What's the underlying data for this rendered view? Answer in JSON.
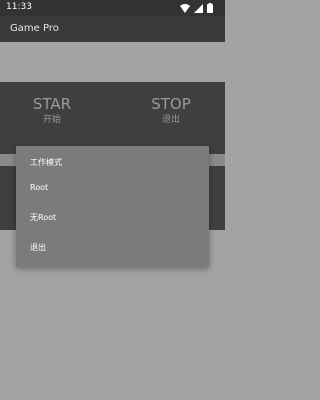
{
  "status_bar": {
    "time": "11:33",
    "icons": [
      "wifi-icon",
      "signal-icon",
      "battery-icon"
    ]
  },
  "app_bar": {
    "title": "Game Pro"
  },
  "actions": {
    "start": {
      "label": "STAR",
      "sublabel": "开始"
    },
    "stop": {
      "label": "STOP",
      "sublabel": "退出"
    }
  },
  "dialog": {
    "title": "工作模式",
    "items": [
      "Root",
      "无Root",
      "退出"
    ]
  },
  "colors": {
    "status_bar": "#333333",
    "app_bar": "#3a3a3a",
    "panel": "#3f3f3f",
    "background": "#a3a3a3",
    "dialog": "#7b7b7b"
  }
}
